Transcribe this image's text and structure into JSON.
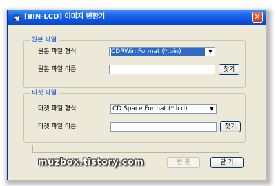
{
  "window": {
    "title": "[BIN-LCD] 이미지 변환기",
    "close_glyph": "✕"
  },
  "source_group": {
    "legend": "원본 파일",
    "format_label": "원본 파일 형식",
    "format_value": "CDRWin   Format (*.bin)",
    "name_label": "원본 파일 이름",
    "name_value": "",
    "find_button": "찾기"
  },
  "target_group": {
    "legend": "타겟 파일",
    "format_label": "타겟 파일 형식",
    "format_value": "CD Space Format (*.lcd)",
    "name_label": "타겟 파일 이름",
    "name_value": "",
    "find_button": "찾기"
  },
  "buttons": {
    "convert": "변   환",
    "close": "닫  기"
  },
  "watermark": "muzbox.tistory.com",
  "icons": {
    "app": "app-logo-icon",
    "dropdown": "chevron-down-icon"
  },
  "colors": {
    "title_bar": "#0a54e0",
    "legend_text": "#0046d5",
    "selection": "#316ac5",
    "close_button": "#c9391c"
  }
}
